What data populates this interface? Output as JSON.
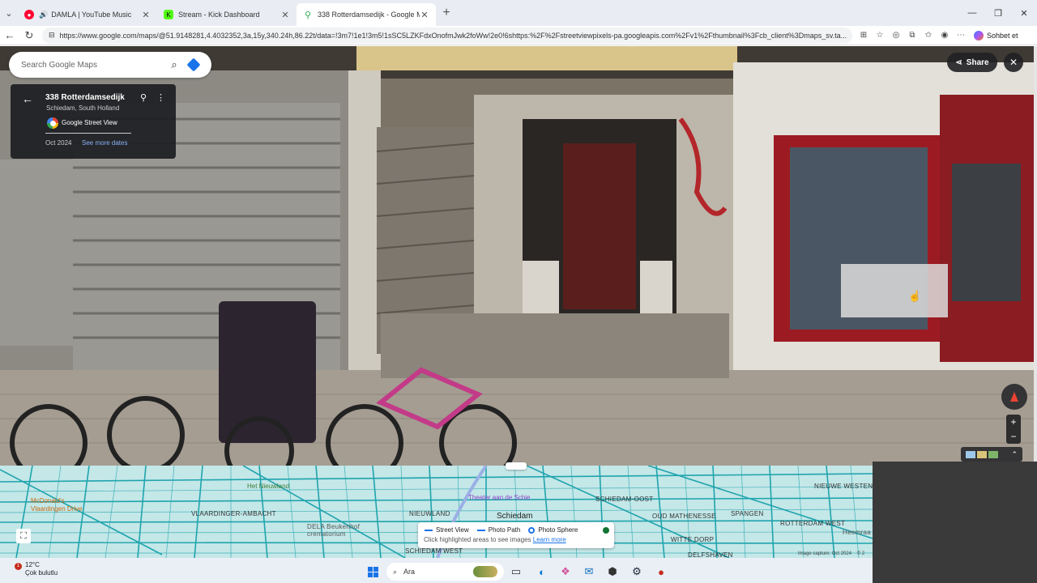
{
  "browser": {
    "tabs": [
      {
        "title": "DAMLA | YouTube Music",
        "icon": "youtube-music-icon",
        "color": "#ff0033"
      },
      {
        "title": "Stream - Kick Dashboard",
        "icon": "kick-icon",
        "color": "#53fc18"
      },
      {
        "title": "338 Rotterdamsedijk - Google Maps",
        "icon": "google-maps-icon",
        "color": "#34a853"
      }
    ],
    "url": "https://www.google.com/maps/@51.9148281,4.4032352,3a,15y,340.24h,86.22t/data=!3m7!1e1!3m5!1sSC5LZKFdxOnofmJwk2foWw!2e0!6shttps:%2F%2Fstreetviewpixels-pa.googleapis.com%2Fv1%2Fthumbnail%3Fcb_client%3Dmaps_sv.ta...",
    "copilot_label": "Sohbet et"
  },
  "maps": {
    "search_placeholder": "Search Google Maps",
    "place": {
      "title": "338 Rotterdamsedijk",
      "subtitle": "Schiedam, South Holland",
      "provider": "Google Street View",
      "date": "Oct 2024",
      "more_dates": "See more dates"
    },
    "share_label": "Share",
    "minimap": {
      "labels": [
        "Het Nieuwland",
        "VLAARDINGER-AMBACHT",
        "NIEUWLAND",
        "Schiedam",
        "Theater aan de Schie",
        "SCHIEDAM-OOST",
        "OUD MATHENESSE",
        "SPANGEN",
        "ROTTERDAM WEST",
        "NIEUWE WESTEN",
        "WITTE DORP",
        "DELFSHAVEN",
        "McDonald's Vlaardingen Drive",
        "DELA Beukenhof crematorium",
        "SCHIEDAM WEST",
        "Heemraa"
      ],
      "legend": {
        "street_view": "Street View",
        "photo_path": "Photo Path",
        "photo_sphere": "Photo Sphere",
        "hint": "Click highlighted areas to see images",
        "learn_more": "Learn more"
      },
      "credit": "Image capture: Oct 2024",
      "credit_suffix": "© 2"
    }
  },
  "taskbar": {
    "weather_temp": "12°C",
    "weather_desc": "Çok bulutlu",
    "notification_count": "1",
    "search_placeholder": "Ara"
  }
}
